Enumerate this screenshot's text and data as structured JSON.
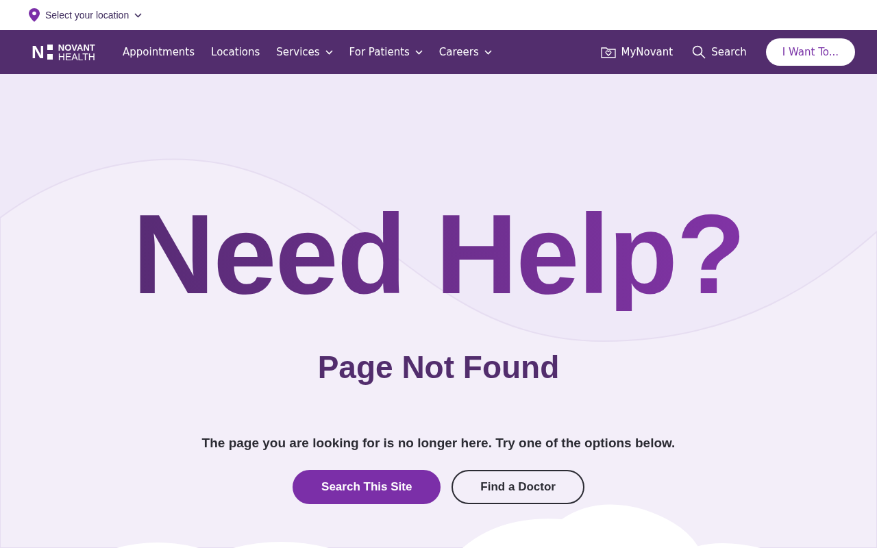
{
  "location_bar": {
    "label": "Select your location"
  },
  "navbar": {
    "logo": {
      "mark": "N",
      "line_1": "NOVANT",
      "line_2": "HEALTH"
    },
    "links": [
      {
        "label": "Appointments",
        "dropdown": false
      },
      {
        "label": "Locations",
        "dropdown": false
      },
      {
        "label": "Services",
        "dropdown": true
      },
      {
        "label": "For Patients",
        "dropdown": true
      },
      {
        "label": "Careers",
        "dropdown": true
      }
    ],
    "mychart": "MyNovant",
    "search": "Search",
    "cta": "I Want To..."
  },
  "hero": {
    "headline": "Need Help?",
    "subtitle": "Page Not Found",
    "message": "The page you are looking for is no longer here. Try one of the options below.",
    "buttons": [
      {
        "label": "Search This Site",
        "kind": "primary"
      },
      {
        "label": "Find a Doctor",
        "kind": "outline"
      }
    ]
  }
}
